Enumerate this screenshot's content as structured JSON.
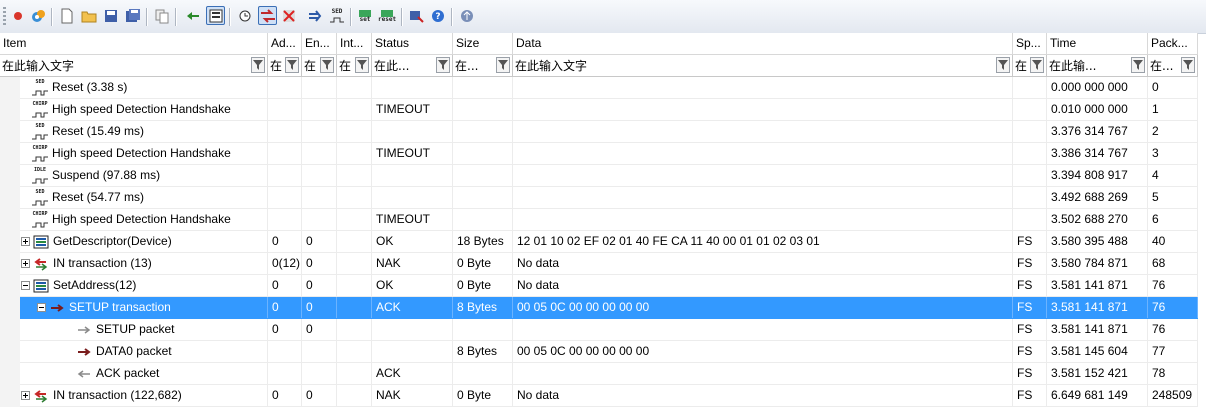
{
  "toolbar": {
    "buttons": [
      {
        "icon": "red-dot-icon"
      },
      {
        "icon": "gear-icon"
      },
      {
        "icon": "new-file-icon"
      },
      {
        "icon": "open-folder-icon"
      },
      {
        "icon": "save-icon"
      },
      {
        "icon": "save-all-icon"
      },
      {
        "icon": "copy-icon"
      },
      {
        "icon": "back-arrow-icon"
      },
      {
        "icon": "list-view-icon",
        "selected": true
      },
      {
        "icon": "clock-icon"
      },
      {
        "icon": "swap-arrows-icon",
        "selected": true
      },
      {
        "icon": "filter-cross-icon"
      },
      {
        "icon": "arrow-right-icon"
      },
      {
        "icon": "sed-icon",
        "text": "SED"
      },
      {
        "icon": "set-icon",
        "text": "set"
      },
      {
        "icon": "reset-icon",
        "text": "reset"
      },
      {
        "icon": "tool-icon"
      },
      {
        "icon": "help-icon"
      },
      {
        "icon": "usb-icon"
      }
    ]
  },
  "columns": {
    "item": "Item",
    "address": "Ad...",
    "endpoint": "En...",
    "interface": "Int...",
    "status": "Status",
    "size": "Size",
    "data": "Data",
    "speed": "Sp...",
    "time": "Time",
    "packet": "Pack..."
  },
  "filters": {
    "item": "在此输入文字",
    "address": "在",
    "endpoint": "在",
    "interface": "在",
    "status": "在此...",
    "size": "在...",
    "data": "在此输入文字",
    "speed": "在",
    "time": "在此输...",
    "packet": "在..."
  },
  "rows": [
    {
      "depth": 1,
      "expander": "",
      "icon": "sed",
      "icon_text": "SED",
      "item": "Reset (3.38 s)",
      "address": "",
      "endpoint": "",
      "status": "",
      "size": "",
      "data": "",
      "speed": "",
      "time": "0.000 000 000",
      "packet": "0"
    },
    {
      "depth": 1,
      "expander": "",
      "icon": "chirp",
      "icon_text": "CHIRP",
      "item": "High speed Detection Handshake",
      "address": "",
      "endpoint": "",
      "status": "TIMEOUT",
      "size": "",
      "data": "",
      "speed": "",
      "time": "0.010 000 000",
      "packet": "1"
    },
    {
      "depth": 1,
      "expander": "",
      "icon": "sed",
      "icon_text": "SED",
      "item": "Reset (15.49 ms)",
      "address": "",
      "endpoint": "",
      "status": "",
      "size": "",
      "data": "",
      "speed": "",
      "time": "3.376 314 767",
      "packet": "2"
    },
    {
      "depth": 1,
      "expander": "",
      "icon": "chirp",
      "icon_text": "CHIRP",
      "item": "High speed Detection Handshake",
      "address": "",
      "endpoint": "",
      "status": "TIMEOUT",
      "size": "",
      "data": "",
      "speed": "",
      "time": "3.386 314 767",
      "packet": "3"
    },
    {
      "depth": 1,
      "expander": "",
      "icon": "idle",
      "icon_text": "IDLE",
      "item": "Suspend (97.88 ms)",
      "address": "",
      "endpoint": "",
      "status": "",
      "size": "",
      "data": "",
      "speed": "",
      "time": "3.394 808 917",
      "packet": "4"
    },
    {
      "depth": 1,
      "expander": "",
      "icon": "sed",
      "icon_text": "SED",
      "item": "Reset (54.77 ms)",
      "address": "",
      "endpoint": "",
      "status": "",
      "size": "",
      "data": "",
      "speed": "",
      "time": "3.492 688 269",
      "packet": "5"
    },
    {
      "depth": 1,
      "expander": "",
      "icon": "chirp",
      "icon_text": "CHIRP",
      "item": "High speed Detection Handshake",
      "address": "",
      "endpoint": "",
      "status": "TIMEOUT",
      "size": "",
      "data": "",
      "speed": "",
      "time": "3.502 688 270",
      "packet": "6"
    },
    {
      "depth": 1,
      "expander": "plus",
      "icon": "request",
      "icon_text": "",
      "item": "GetDescriptor(Device)",
      "address": "0",
      "endpoint": "0",
      "status": "OK",
      "size": "18 Bytes",
      "data": "12 01 10 02 EF 02 01 40 FE CA 11 40 00 01 01 02 03 01",
      "speed": "FS",
      "time": "3.580 395 488",
      "packet": "40"
    },
    {
      "depth": 1,
      "expander": "plus",
      "icon": "in-transaction",
      "icon_text": "",
      "item": "IN transaction (13)",
      "address": "0(12)",
      "endpoint": "0",
      "status": "NAK",
      "size": "0 Byte",
      "data": "No data",
      "speed": "FS",
      "time": "3.580 784 871",
      "packet": "68"
    },
    {
      "depth": 1,
      "expander": "minus",
      "icon": "request",
      "icon_text": "",
      "item": "SetAddress(12)",
      "address": "0",
      "endpoint": "0",
      "status": "OK",
      "size": "0 Byte",
      "data": "No data",
      "speed": "FS",
      "time": "3.581 141 871",
      "packet": "76"
    },
    {
      "depth": 2,
      "expander": "minus",
      "icon": "setup-transaction",
      "icon_text": "",
      "item": "SETUP transaction",
      "address": "0",
      "endpoint": "0",
      "status": "ACK",
      "size": "8 Bytes",
      "data": "00 05 0C 00 00 00 00 00",
      "speed": "FS",
      "time": "3.581 141 871",
      "packet": "76",
      "selected": true
    },
    {
      "depth": 3,
      "expander": "",
      "icon": "packet-out",
      "icon_text": "",
      "item": "SETUP packet",
      "address": "0",
      "endpoint": "0",
      "status": "",
      "size": "",
      "data": "",
      "speed": "FS",
      "time": "3.581 141 871",
      "packet": "76"
    },
    {
      "depth": 3,
      "expander": "",
      "icon": "packet-data",
      "icon_text": "",
      "item": "DATA0 packet",
      "address": "",
      "endpoint": "",
      "status": "",
      "size": "8 Bytes",
      "data": "00 05 0C 00 00 00 00 00",
      "speed": "FS",
      "time": "3.581 145 604",
      "packet": "77"
    },
    {
      "depth": 3,
      "expander": "",
      "icon": "packet-in",
      "icon_text": "",
      "item": "ACK packet",
      "address": "",
      "endpoint": "",
      "status": "ACK",
      "size": "",
      "data": "",
      "speed": "FS",
      "time": "3.581 152 421",
      "packet": "78"
    },
    {
      "depth": 1,
      "expander": "plus",
      "icon": "in-transaction",
      "icon_text": "",
      "item": "IN transaction (122,682)",
      "address": "0",
      "endpoint": "0",
      "status": "NAK",
      "size": "0 Byte",
      "data": "No data",
      "speed": "FS",
      "time": "6.649 681 149",
      "packet": "248509"
    }
  ]
}
